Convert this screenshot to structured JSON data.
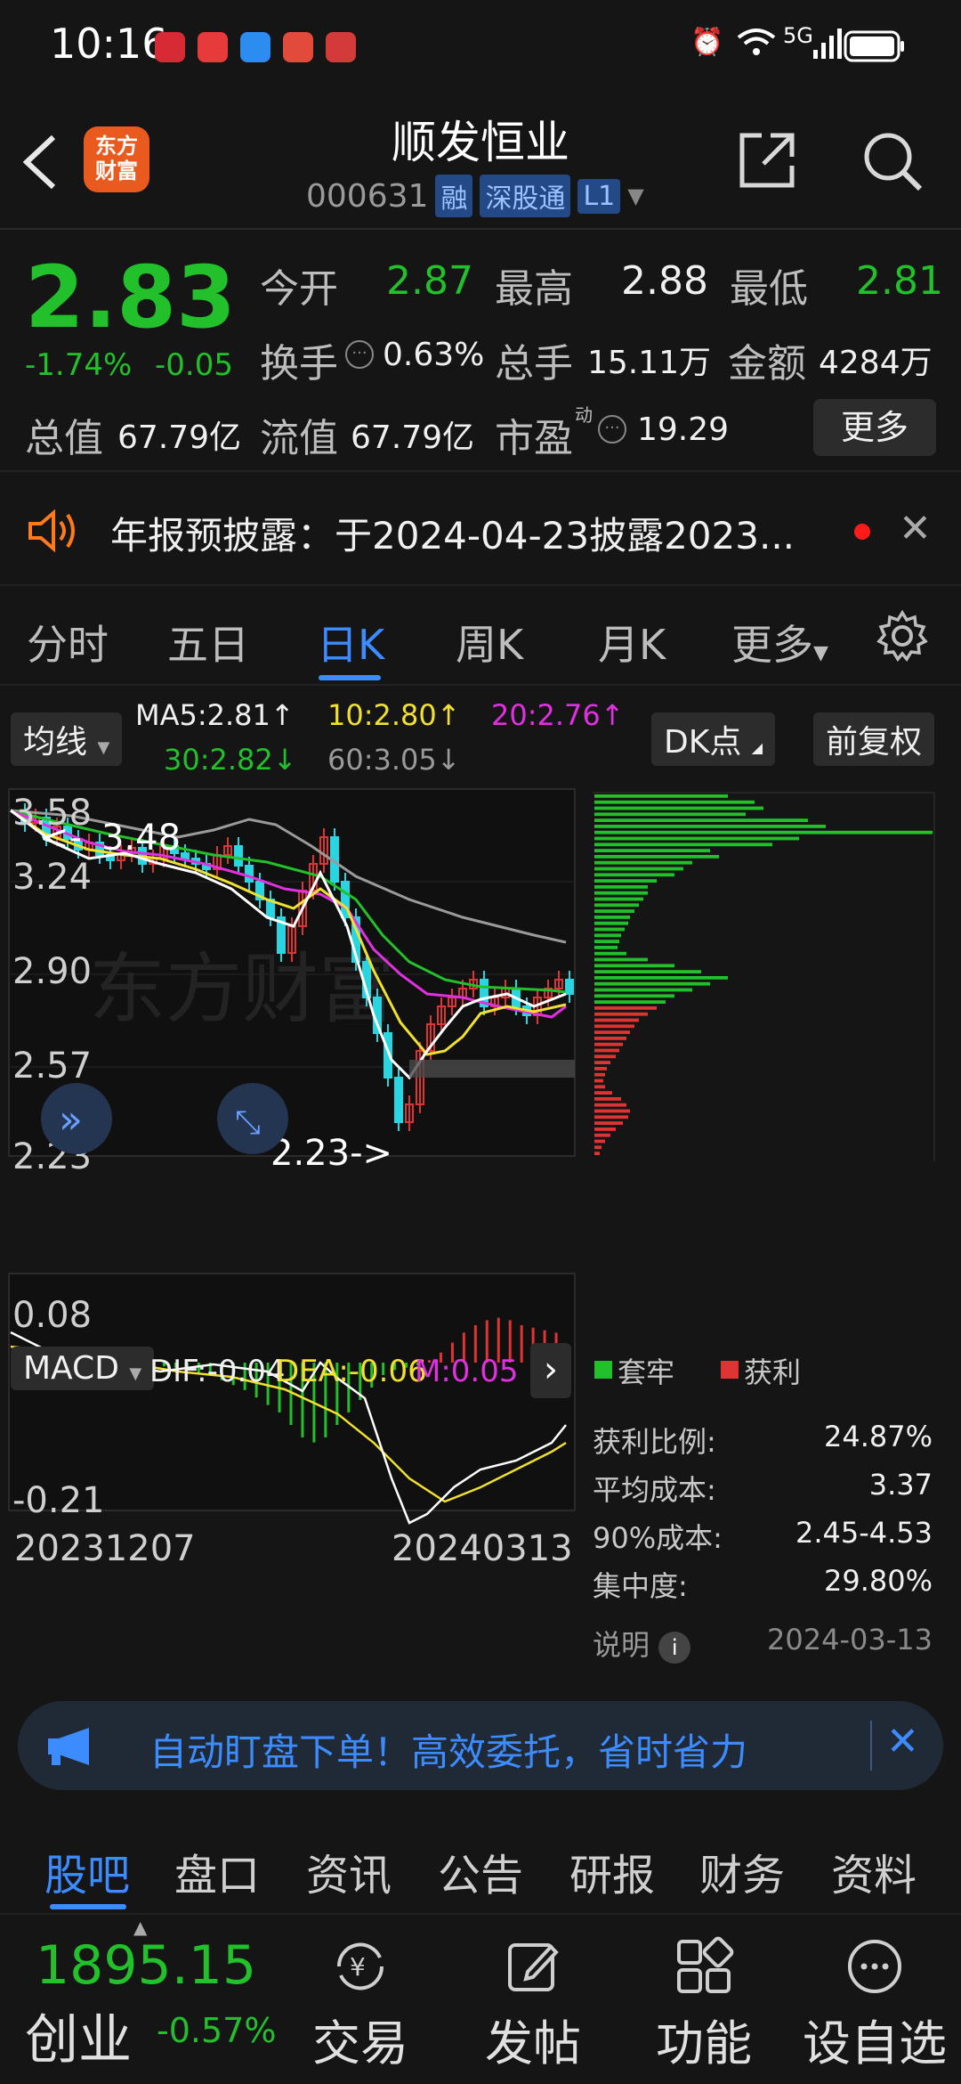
{
  "status_bar": {
    "time": "10:16",
    "network": "5G"
  },
  "header": {
    "title": "顺发恒业",
    "code": "000631",
    "tags": [
      "融",
      "深股通",
      "L1"
    ],
    "logo_text_1": "东方",
    "logo_text_2": "财富"
  },
  "quote": {
    "price": "2.83",
    "change_pct": "-1.74%",
    "change": "-0.05",
    "open_label": "今开",
    "open": "2.87",
    "high_label": "最高",
    "high": "2.88",
    "low_label": "最低",
    "low": "2.81",
    "turnover_label": "换手",
    "turnover": "0.63%",
    "volume_label": "总手",
    "volume": "15.11万",
    "amount_label": "金额",
    "amount": "4284万",
    "total_cap_label": "总值",
    "total_cap": "67.79亿",
    "float_cap_label": "流值",
    "float_cap": "67.79亿",
    "pe_label": "市盈",
    "pe_sup": "动",
    "pe": "19.29",
    "more_label": "更多"
  },
  "notice": {
    "text": "年报预披露：于2024-04-23披露2023..."
  },
  "kline_tabs": {
    "items": [
      "分时",
      "五日",
      "日K",
      "周K",
      "月K",
      "更多"
    ],
    "active": "日K"
  },
  "ma": {
    "selector": "均线",
    "ma5": "MA5:2.81↑",
    "ma10": "10:2.80↑",
    "ma20": "20:2.76↑",
    "ma30": "30:2.82↓",
    "ma60": "60:3.05↓",
    "dk_label": "DK点",
    "adjust_label": "前复权"
  },
  "chart_data": {
    "type": "candlestick",
    "price_axis": [
      "3.58",
      "3.24",
      "2.90",
      "2.57",
      "2.23"
    ],
    "annotations": {
      "high": "3.48",
      "low": "2.23->",
      "high_prefix": "<-"
    },
    "watermark": "东方财富",
    "x_start": "20231207",
    "x_end": "20240313",
    "ylim": [
      2.23,
      3.58
    ]
  },
  "macd": {
    "selector": "MACD",
    "dif": "DIF:-0.04",
    "dea": "DEA:-0.06",
    "m": "M:0.05",
    "axis_top": "0.08",
    "axis_bottom": "-0.21"
  },
  "chip_dist": {
    "legend_trapped": "套牢",
    "legend_profit": "获利",
    "rows": [
      {
        "label": "获利比例:",
        "value": "24.87%"
      },
      {
        "label": "平均成本:",
        "value": "3.37"
      },
      {
        "label": "90%成本:",
        "value": "2.45-4.53"
      },
      {
        "label": "集中度:",
        "value": "29.80%"
      }
    ],
    "explain_label": "说明",
    "date": "2024-03-13"
  },
  "banner": {
    "text": "自动盯盘下单！高效委托，省时省力"
  },
  "bottom_tabs": {
    "items": [
      "股吧",
      "盘口",
      "资讯",
      "公告",
      "研报",
      "财务",
      "资料"
    ],
    "active": "股吧"
  },
  "bottom_nav": {
    "index_value": "1895.15",
    "index_name": "创业",
    "index_change": "-0.57%",
    "items": [
      "交易",
      "发帖",
      "功能",
      "设自选"
    ]
  },
  "colors": {
    "up": "#e03434",
    "down": "#22c02a",
    "accent": "#3d8cff",
    "background": "#151515"
  }
}
